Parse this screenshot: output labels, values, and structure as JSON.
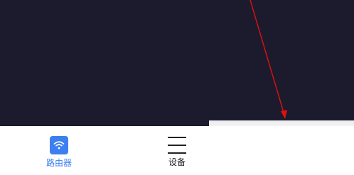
{
  "tabbar": {
    "tabs": [
      {
        "label": "路由器",
        "icon": "wifi-icon",
        "active": true
      },
      {
        "label": "设备",
        "icon": "hamburger-menu-icon",
        "active": false
      }
    ]
  },
  "colors": {
    "background_dark": "#1b1b2d",
    "accent": "#3d7ff0",
    "annotation_arrow": "#e01010"
  }
}
